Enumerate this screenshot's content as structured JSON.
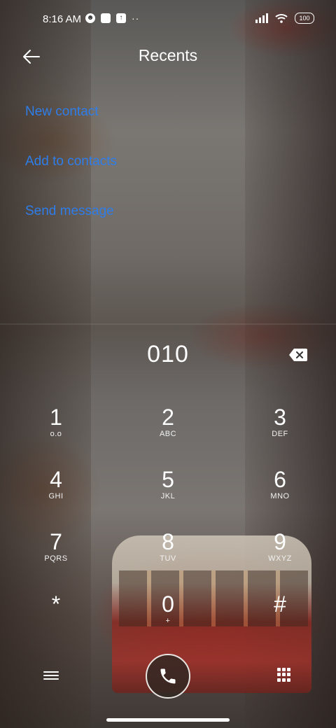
{
  "status": {
    "time": "8:16 AM",
    "battery": "100"
  },
  "header": {
    "title": "Recents"
  },
  "actions": [
    {
      "label": "New contact"
    },
    {
      "label": "Add to contacts"
    },
    {
      "label": "Send message"
    }
  ],
  "dialer": {
    "number": "010",
    "keys": [
      {
        "digit": "1",
        "letters": "ᴏ.ᴏ"
      },
      {
        "digit": "2",
        "letters": "ABC"
      },
      {
        "digit": "3",
        "letters": "DEF"
      },
      {
        "digit": "4",
        "letters": "GHI"
      },
      {
        "digit": "5",
        "letters": "JKL"
      },
      {
        "digit": "6",
        "letters": "MNO"
      },
      {
        "digit": "7",
        "letters": "PQRS"
      },
      {
        "digit": "8",
        "letters": "TUV"
      },
      {
        "digit": "9",
        "letters": "WXYZ"
      },
      {
        "digit": "*",
        "letters": ""
      },
      {
        "digit": "0",
        "letters": "+"
      },
      {
        "digit": "#",
        "letters": ""
      }
    ]
  },
  "colors": {
    "link": "#2f7de8"
  },
  "icons": {
    "back": "arrow-left-icon",
    "backspace": "backspace-icon",
    "menu": "menu-icon",
    "call": "phone-icon",
    "dialpad": "dialpad-icon"
  }
}
